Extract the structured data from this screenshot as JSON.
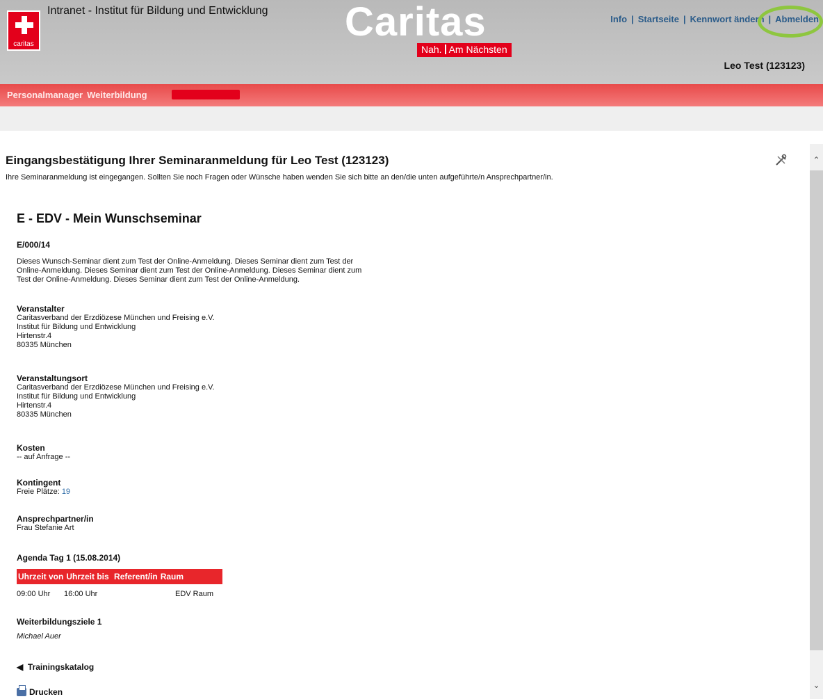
{
  "header": {
    "logo_text": "caritas",
    "app_title": "Intranet - Institut für Bildung und Entwicklung",
    "brand": "Caritas",
    "brand_sub_1": "Nah.",
    "brand_sub_2": "Am Nächsten",
    "nav": {
      "info": "Info",
      "start": "Startseite",
      "password": "Kennwort ändern",
      "logout": "Abmelden"
    },
    "user": "Leo  Test (123123)"
  },
  "redbar": {
    "item1": "Personalmanager",
    "item2": "Weiterbildung"
  },
  "page": {
    "title": "Eingangsbestätigung Ihrer Seminaranmeldung für Leo Test (123123)",
    "intro": "Ihre Seminaranmeldung ist eingegangen. Sollten Sie noch Fragen oder Wünsche haben wenden Sie sich bitte an den/die unten aufgeführte/n Ansprechpartner/in.",
    "seminar_title": "E - EDV - Mein Wunschseminar",
    "code": "E/000/14",
    "description_1": "Dieses Wunsch-Seminar dient zum Test der Online-Anmeldung. Dieses Seminar dient zum Test der",
    "description_2": "Online-Anmeldung. Dieses Seminar dient zum Test der Online-Anmeldung. Dieses Seminar dient zum",
    "description_3": "Test der Online-Anmeldung. Dieses Seminar dient zum Test der Online-Anmeldung.",
    "organizer": {
      "heading": "Veranstalter",
      "line1": "Caritasverband der Erzdiözese München und Freising e.V.",
      "line2": "Institut für Bildung und Entwicklung",
      "line3": "Hirtenstr.4",
      "line4": "80335 München"
    },
    "venue": {
      "heading": "Veranstaltungsort",
      "line1": "Caritasverband der Erzdiözese München und Freising e.V.",
      "line2": "Institut für Bildung und Entwicklung",
      "line3": "Hirtenstr.4",
      "line4": "80335 München"
    },
    "cost": {
      "heading": "Kosten",
      "value": "-- auf Anfrage --"
    },
    "quota": {
      "heading": "Kontingent",
      "label": "Freie Plätze:",
      "value": "19"
    },
    "contact": {
      "heading": "Ansprechpartner/in",
      "value": "Frau Stefanie Art"
    },
    "agenda": {
      "heading": "Agenda Tag 1   (15.08.2014)",
      "columns": [
        "Uhrzeit von",
        "Uhrzeit bis",
        "Referent/in",
        "Raum"
      ],
      "row": {
        "from": "09:00 Uhr",
        "to": "16:00 Uhr",
        "room": "EDV Raum"
      }
    },
    "goals": {
      "heading": "Weiterbildungsziele 1",
      "value": "Michael Auer"
    },
    "catalog_link": "Trainingskatalog",
    "print_link": "Drucken"
  },
  "colors": {
    "accent_red": "#e3001b",
    "link_blue": "#2b5c8a",
    "highlight_green": "#8ec63f"
  }
}
